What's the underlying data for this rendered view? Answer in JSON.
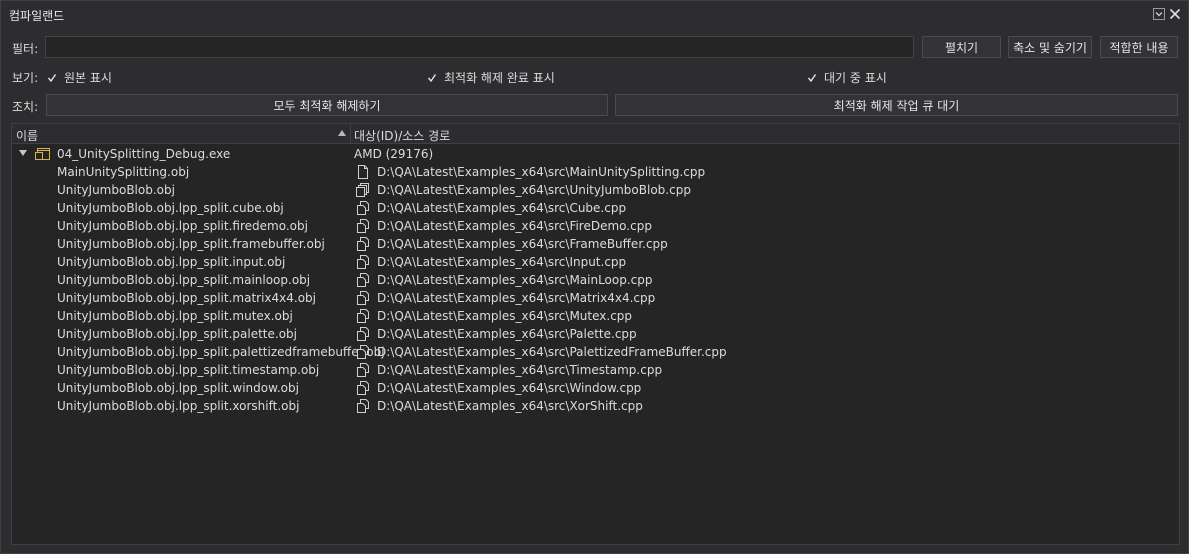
{
  "window": {
    "title": "컴파일랜드",
    "colors": {
      "background": "#2d2d30",
      "panel": "#252526",
      "border": "#3f3f46",
      "text": "#dcdcdc",
      "exe_icon": "#d9b44a"
    }
  },
  "filter": {
    "label": "필터:",
    "value": "",
    "buttons": {
      "expand": "펼치기",
      "collapse_hide": "축소 및 숨기기",
      "fit_content": "적합한 내용"
    }
  },
  "view": {
    "label": "보기:",
    "options": [
      {
        "label": "원본 표시",
        "checked": true
      },
      {
        "label": "최적화 해제 완료 표시",
        "checked": true
      },
      {
        "label": "대기 중 표시",
        "checked": true
      }
    ]
  },
  "actions": {
    "label": "조치:",
    "optimize_all": "모두 최적화 해제하기",
    "queue_deoptimize": "최적화 해제 작업 큐 대기"
  },
  "table": {
    "columns": {
      "name": "이름",
      "target": "대상(ID)/소스 경로"
    },
    "root": {
      "name": "04_UnitySplitting_Debug.exe",
      "target": "AMD (29176)",
      "icon": "exe-icon",
      "expanded": true
    },
    "rows": [
      {
        "name": "MainUnitySplitting.obj",
        "path": "D:\\QA\\Latest\\Examples_x64\\src\\MainUnitySplitting.cpp",
        "icon": "file-icon"
      },
      {
        "name": "UnityJumboBlob.obj",
        "path": "D:\\QA\\Latest\\Examples_x64\\src\\UnityJumboBlob.cpp",
        "icon": "multi-file-icon"
      },
      {
        "name": "UnityJumboBlob.obj.lpp_split.cube.obj",
        "path": "D:\\QA\\Latest\\Examples_x64\\src\\Cube.cpp",
        "icon": "split-file-icon"
      },
      {
        "name": "UnityJumboBlob.obj.lpp_split.firedemo.obj",
        "path": "D:\\QA\\Latest\\Examples_x64\\src\\FireDemo.cpp",
        "icon": "split-file-icon"
      },
      {
        "name": "UnityJumboBlob.obj.lpp_split.framebuffer.obj",
        "path": "D:\\QA\\Latest\\Examples_x64\\src\\FrameBuffer.cpp",
        "icon": "split-file-icon"
      },
      {
        "name": "UnityJumboBlob.obj.lpp_split.input.obj",
        "path": "D:\\QA\\Latest\\Examples_x64\\src\\Input.cpp",
        "icon": "split-file-icon"
      },
      {
        "name": "UnityJumboBlob.obj.lpp_split.mainloop.obj",
        "path": "D:\\QA\\Latest\\Examples_x64\\src\\MainLoop.cpp",
        "icon": "split-file-icon"
      },
      {
        "name": "UnityJumboBlob.obj.lpp_split.matrix4x4.obj",
        "path": "D:\\QA\\Latest\\Examples_x64\\src\\Matrix4x4.cpp",
        "icon": "split-file-icon"
      },
      {
        "name": "UnityJumboBlob.obj.lpp_split.mutex.obj",
        "path": "D:\\QA\\Latest\\Examples_x64\\src\\Mutex.cpp",
        "icon": "split-file-icon"
      },
      {
        "name": "UnityJumboBlob.obj.lpp_split.palette.obj",
        "path": "D:\\QA\\Latest\\Examples_x64\\src\\Palette.cpp",
        "icon": "split-file-icon"
      },
      {
        "name": "UnityJumboBlob.obj.lpp_split.palettizedframebuffer.obj",
        "path": "D:\\QA\\Latest\\Examples_x64\\src\\PalettizedFrameBuffer.cpp",
        "icon": "split-file-icon"
      },
      {
        "name": "UnityJumboBlob.obj.lpp_split.timestamp.obj",
        "path": "D:\\QA\\Latest\\Examples_x64\\src\\Timestamp.cpp",
        "icon": "split-file-icon"
      },
      {
        "name": "UnityJumboBlob.obj.lpp_split.window.obj",
        "path": "D:\\QA\\Latest\\Examples_x64\\src\\Window.cpp",
        "icon": "split-file-icon"
      },
      {
        "name": "UnityJumboBlob.obj.lpp_split.xorshift.obj",
        "path": "D:\\QA\\Latest\\Examples_x64\\src\\XorShift.cpp",
        "icon": "split-file-icon"
      }
    ]
  }
}
